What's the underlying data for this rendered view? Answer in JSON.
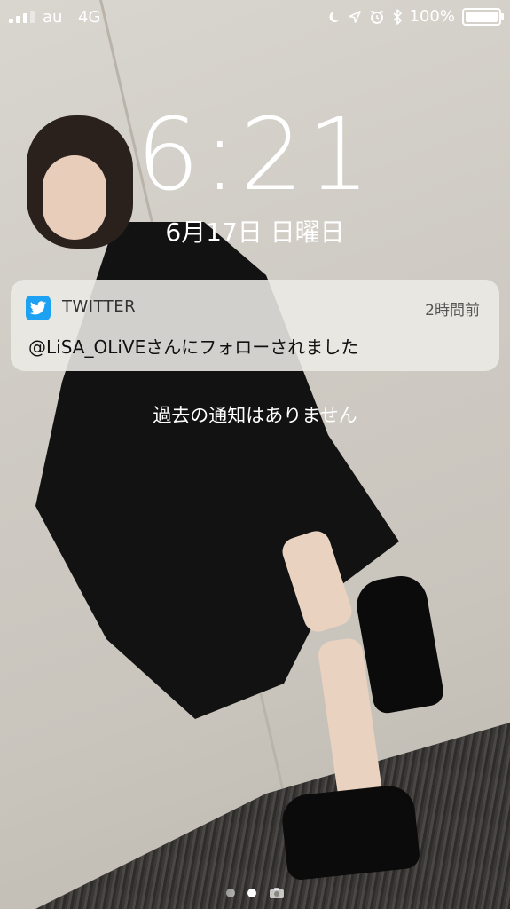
{
  "status_bar": {
    "carrier": "au",
    "network": "4G",
    "battery_label": "100%",
    "battery_level": 1.0,
    "icons": [
      "moon-icon",
      "location-arrow-icon",
      "alarm-icon",
      "bluetooth-icon",
      "battery-icon"
    ]
  },
  "lock_screen": {
    "time": "6:21",
    "date": "6月17日 日曜日"
  },
  "notification": {
    "app_name": "TWITTER",
    "time_ago": "2時間前",
    "message": "@LiSA_OLiVEさんにフォローされました",
    "app_icon": "twitter-bird-icon",
    "accent_color": "#1da1f2"
  },
  "no_older_notifications": "過去の通知はありません",
  "page_indicator": {
    "pages": 2,
    "current": 2,
    "extra_icon": "camera-icon"
  }
}
